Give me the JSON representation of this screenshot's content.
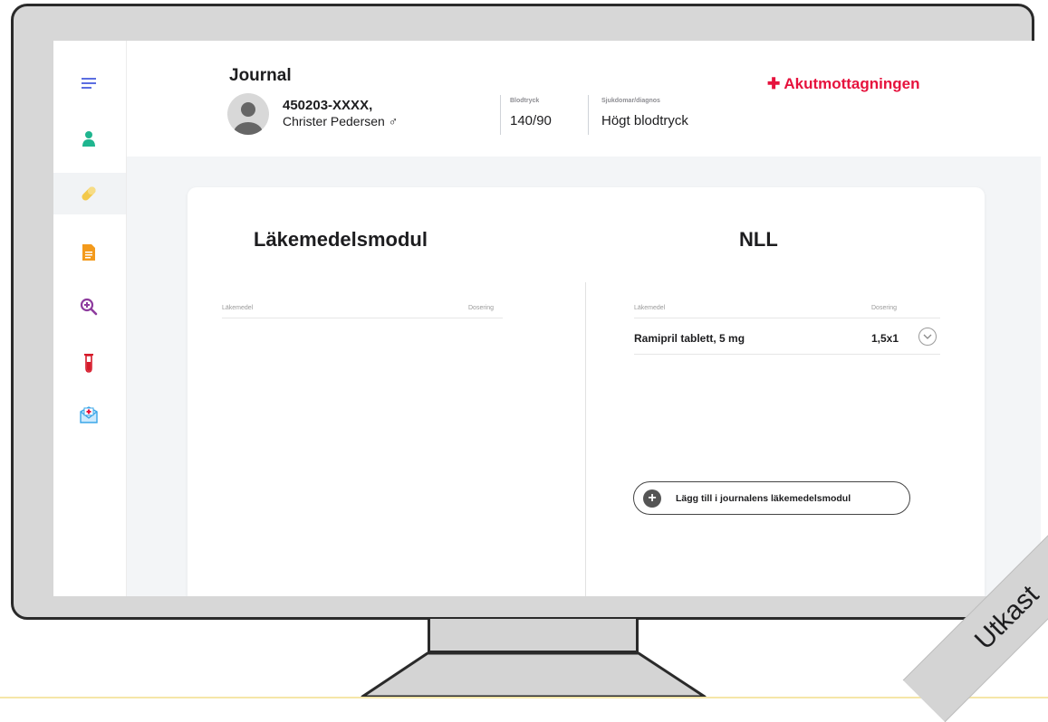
{
  "header": {
    "title": "Journal",
    "patient_id": "450203-XXXX,",
    "patient_name": "Christer Pedersen ♂",
    "blood_pressure_label": "Blodtryck",
    "blood_pressure_value": "140/90",
    "diagnosis_label": "Sjukdomar/diagnos",
    "diagnosis_value": "Högt blodtryck",
    "emergency_label": "✚ Akutmottagningen"
  },
  "sidebar": {
    "items": [
      {
        "icon": "menu-icon"
      },
      {
        "icon": "person-icon"
      },
      {
        "icon": "pill-icon",
        "active": true
      },
      {
        "icon": "document-icon"
      },
      {
        "icon": "search-plus-icon"
      },
      {
        "icon": "test-tube-icon"
      },
      {
        "icon": "medical-mail-icon"
      }
    ]
  },
  "left_panel": {
    "title": "Läkemedelsmodul",
    "columns": [
      "Läkemedel",
      "Dosering"
    ]
  },
  "right_panel": {
    "title": "NLL",
    "columns": [
      "Läkemedel",
      "Dosering"
    ],
    "rows": [
      {
        "name": "Ramipril tablett, 5 mg",
        "dose": "1,5x1"
      }
    ],
    "add_button": "Lägg till i journalens läkemedelsmodul"
  },
  "watermark": "Utkast",
  "colors": {
    "accent_red": "#e6123d",
    "menu_blue": "#5b6ee1",
    "person_green": "#1fb58f",
    "pill_yellow": "#f3c94b",
    "doc_orange": "#f39a1c",
    "search_purple": "#8e3c9e",
    "tube_red": "#d61a2a",
    "mail_blue": "#3aa6e8"
  }
}
